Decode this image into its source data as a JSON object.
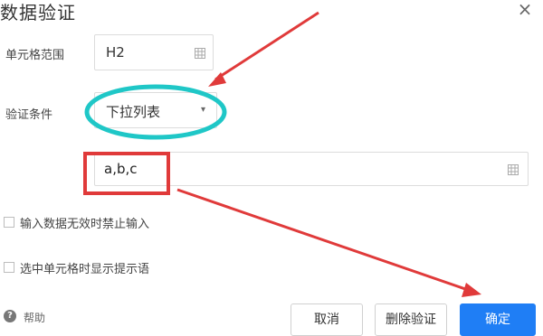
{
  "dialog": {
    "title": "数据验证",
    "close_icon": "close-icon"
  },
  "fields": {
    "range_label": "单元格范围",
    "range_value": "H2",
    "condition_label": "验证条件",
    "condition_value": "下拉列表",
    "source_value": "a,b,c"
  },
  "options": {
    "block_invalid": "输入数据无效时禁止输入",
    "show_prompt": "选中单元格时显示提示语"
  },
  "footer": {
    "help_label": "帮助",
    "cancel_label": "取消",
    "delete_label": "删除验证",
    "ok_label": "确定"
  },
  "colors": {
    "accent": "#1f7ef5",
    "annotation_red": "#e03a3a",
    "annotation_teal": "#1fc7c7"
  }
}
